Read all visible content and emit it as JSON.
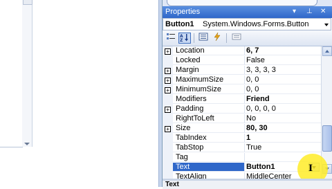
{
  "properties_window": {
    "title": "Properties",
    "title_icons": [
      "pin-dropdown-icon",
      "pin-icon",
      "close-icon"
    ],
    "object_name": "Button1",
    "object_type": "System.Windows.Forms.Button"
  },
  "toolbar": {
    "buttons": [
      "categorized-icon",
      "alphabetical-icon",
      "properties-icon",
      "events-icon",
      "property-pages-icon"
    ]
  },
  "grid": {
    "rows": [
      {
        "name": "Location",
        "value": "6, 7",
        "expandable": true,
        "bold": true
      },
      {
        "name": "Locked",
        "value": "False",
        "expandable": false,
        "bold": false
      },
      {
        "name": "Margin",
        "value": "3, 3, 3, 3",
        "expandable": true,
        "bold": false
      },
      {
        "name": "MaximumSize",
        "value": "0, 0",
        "expandable": true,
        "bold": false
      },
      {
        "name": "MinimumSize",
        "value": "0, 0",
        "expandable": true,
        "bold": false
      },
      {
        "name": "Modifiers",
        "value": "Friend",
        "expandable": false,
        "bold": true
      },
      {
        "name": "Padding",
        "value": "0, 0, 0, 0",
        "expandable": true,
        "bold": false
      },
      {
        "name": "RightToLeft",
        "value": "No",
        "expandable": false,
        "bold": false
      },
      {
        "name": "Size",
        "value": "80, 30",
        "expandable": true,
        "bold": true
      },
      {
        "name": "TabIndex",
        "value": "1",
        "expandable": false,
        "bold": true
      },
      {
        "name": "TabStop",
        "value": "True",
        "expandable": false,
        "bold": false
      },
      {
        "name": "Tag",
        "value": "",
        "expandable": false,
        "bold": false
      },
      {
        "name": "Text",
        "value": "Button1",
        "expandable": false,
        "bold": true,
        "selected": true
      },
      {
        "name": "TextAlign",
        "value": "MiddleCenter",
        "expandable": false,
        "bold": false
      }
    ]
  },
  "description": {
    "title": "Text"
  },
  "colors": {
    "title_bar": "#2f67c9",
    "selection": "#2f67c9",
    "cursor_highlight": "#ffec28"
  }
}
